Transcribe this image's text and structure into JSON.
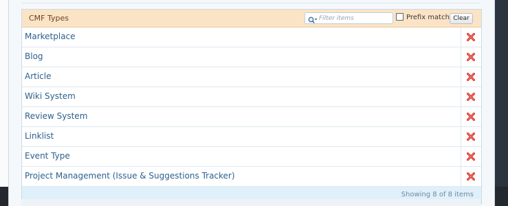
{
  "panel": {
    "title": "CMF Types",
    "filter_placeholder": "Filter items",
    "prefix_match_label": "Prefix match",
    "clear_label": "Clear",
    "footer_text": "Showing 8 of 8 items"
  },
  "items": [
    {
      "label": "Marketplace"
    },
    {
      "label": "Blog"
    },
    {
      "label": "Article"
    },
    {
      "label": "Wiki System"
    },
    {
      "label": "Review System"
    },
    {
      "label": "Linklist"
    },
    {
      "label": "Event Type"
    },
    {
      "label": "Project Management (Issue & Suggestions Tracker)"
    }
  ],
  "icons": {
    "filter": "magnifier-dropdown-icon",
    "delete": "delete-x-icon"
  },
  "colors": {
    "header_bg": "#fbe3c6",
    "link": "#2b5f8e",
    "delete_red": "#d93a32",
    "footer_bg": "#dff0fa"
  }
}
